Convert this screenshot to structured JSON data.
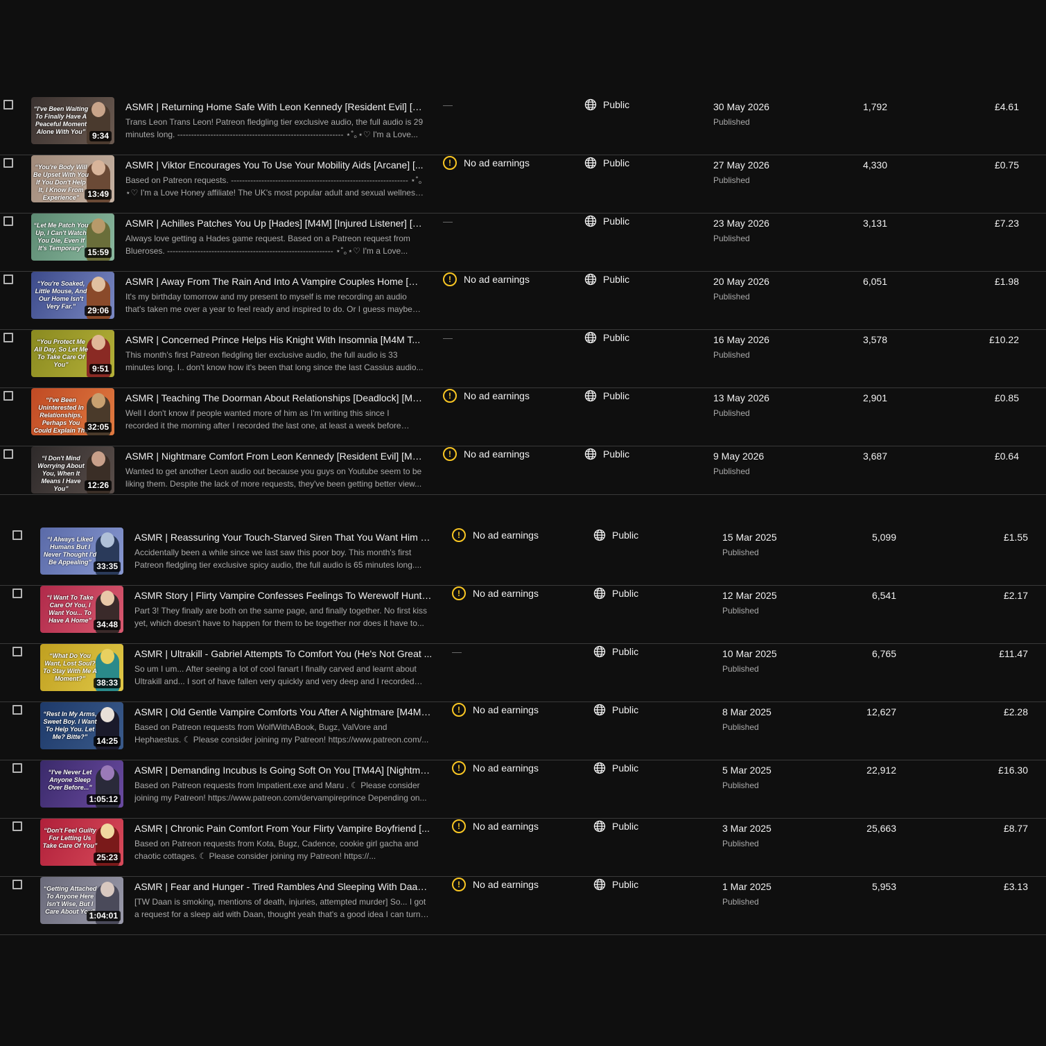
{
  "labels": {
    "published": "Published"
  },
  "group1": [
    {
      "quote": "“I've Been Waiting To Finally Have A Peaceful Moment Alone With You”",
      "duration": "9:34",
      "title": "ASMR | Returning Home Safe With Leon Kennedy [Resident Evil] [T...",
      "description": "Trans Leon Trans Leon! Patreon fledgling tier exclusive audio, the full audio is 29 minutes long. ------------------------------------------------------------ ⋆˚｡⋆♡ I'm a Love...",
      "restriction": "—",
      "visibility": "Public",
      "date": "30 May 2026",
      "status": "Published",
      "views": "1,792",
      "revenue": "£4.61",
      "colors": {
        "bg1": "#3a3230",
        "bg2": "#6b5a50",
        "figure": "#4a3a2e",
        "head": "#c8a48a"
      }
    },
    {
      "quote": "“You're Body Will Be Upset With You If You Don't Help It, I Know From Experience”",
      "duration": "13:49",
      "title": "ASMR | Viktor Encourages You To Use Your Mobility Aids [Arcane] [...",
      "description": "Based on Patreon requests. ---------------------------------------------------------------- ⋆˚｡⋆♡ I'm a Love Honey affiliate! The UK's most popular adult and sexual wellness sto...",
      "restriction": "No ad earnings",
      "visibility": "Public",
      "date": "27 May 2026",
      "status": "Published",
      "views": "4,330",
      "revenue": "£0.75",
      "colors": {
        "bg1": "#a08a7a",
        "bg2": "#c6b2a2",
        "figure": "#6b4a36",
        "head": "#d8b49a"
      }
    },
    {
      "quote": "“Let Me Patch You Up, I Can't Watch You Die, Even If It's Temporary”",
      "duration": "15:59",
      "title": "ASMR | Achilles Patches You Up [Hades] [M4M] [Injured Listener] [R...",
      "description": "Always love getting a Hades game request. Based on a Patreon request from Blueroses. ------------------------------------------------------------ ⋆˚｡⋆♡ I'm a Love...",
      "restriction": "—",
      "visibility": "Public",
      "date": "23 May 2026",
      "status": "Published",
      "views": "3,131",
      "revenue": "£7.23",
      "colors": {
        "bg1": "#5c8a72",
        "bg2": "#8ab89e",
        "figure": "#6a6e3a",
        "head": "#b89a6a"
      }
    },
    {
      "quote": "“You're Soaked, Little Mouse, And Our Home Isn't Very Far.”",
      "duration": "29:06",
      "title": "ASMR | Away From The Rain And Into A Vampire Couples Home [M...",
      "description": "It's my birthday tomorrow and my present to myself is me recording an audio that's taken me over a year to feel ready and inspired to do. Or I guess maybe I'...",
      "restriction": "No ad earnings",
      "visibility": "Public",
      "date": "20 May 2026",
      "status": "Published",
      "views": "6,051",
      "revenue": "£1.98",
      "colors": {
        "bg1": "#3c4a8a",
        "bg2": "#7a88c2",
        "figure": "#8a4a2a",
        "head": "#e0c0a0"
      }
    },
    {
      "quote": "“You Protect Me All Day, So Let Me To Take Care Of You”",
      "duration": "9:51",
      "title": "ASMR | Concerned Prince Helps His Knight With Insomnia [M4M T...",
      "description": "This month's first Patreon fledgling tier exclusive audio, the full audio is 33 minutes long. I.. don't know how it's been that long since the last Cassius audio...",
      "restriction": "—",
      "visibility": "Public",
      "date": "16 May 2026",
      "status": "Published",
      "views": "3,578",
      "revenue": "£10.22",
      "colors": {
        "bg1": "#8a8a20",
        "bg2": "#b4b038",
        "figure": "#8a2a24",
        "head": "#e0b898"
      }
    },
    {
      "quote": "“I've Been Uninterested In Relationships, Perhaps You Could Explain The Appeal”",
      "duration": "32:05",
      "title": "ASMR | Teaching The Doorman About Relationships [Deadlock] [M4...",
      "description": "Well I don't know if people wanted more of him as I'm writing this since I recorded it the morning after I recorded the last one, at least a week before that...",
      "restriction": "No ad earnings",
      "visibility": "Public",
      "date": "13 May 2026",
      "status": "Published",
      "views": "2,901",
      "revenue": "£0.85",
      "colors": {
        "bg1": "#c04a24",
        "bg2": "#e07a40",
        "figure": "#4a3a2a",
        "head": "#c8a070"
      }
    },
    {
      "quote": "“I Don't Mind Worrying About You, When It Means I Have You”",
      "duration": "12:26",
      "title": "ASMR | Nightmare Comfort From Leon Kennedy [Resident Evil] [M4...",
      "description": "Wanted to get another Leon audio out because you guys on Youtube seem to be liking them. Despite the lack of more requests, they've been getting better view...",
      "restriction": "No ad earnings",
      "visibility": "Public",
      "date": "9 May 2026",
      "status": "Published",
      "views": "3,687",
      "revenue": "£0.64",
      "colors": {
        "bg1": "#2e2a2a",
        "bg2": "#5a4e4a",
        "figure": "#3a2e26",
        "head": "#c8a08a"
      }
    }
  ],
  "group2": [
    {
      "quote": "“I Always Liked Humans But I Never Thought I'd Be Appealing”",
      "duration": "33:35",
      "title": "ASMR | Reassuring Your Touch-Starved Siren That You Want Him To...",
      "description": "Accidentally been a while since we last saw this poor boy. This month's first Patreon fledgling tier exclusive spicy audio, the full audio is 65 minutes long....",
      "restriction": "No ad earnings",
      "visibility": "Public",
      "date": "15 Mar 2025",
      "status": "Published",
      "views": "5,099",
      "revenue": "£1.55",
      "colors": {
        "bg1": "#5a6aa8",
        "bg2": "#8898d0",
        "figure": "#2a3a5a",
        "head": "#b0c0d8"
      }
    },
    {
      "quote": "“I Want To Take Care Of You, I Want You... To Have A Home”",
      "duration": "34:48",
      "title": "ASMR Story | Flirty Vampire Confesses Feelings To Werewolf Hunte...",
      "description": "Part 3! They finally are both on the same page, and finally together. No first kiss yet, which doesn't have to happen for them to be together nor does it have to...",
      "restriction": "No ad earnings",
      "visibility": "Public",
      "date": "12 Mar 2025",
      "status": "Published",
      "views": "6,541",
      "revenue": "£2.17",
      "colors": {
        "bg1": "#b02a4a",
        "bg2": "#d85a70",
        "figure": "#3a2a2a",
        "head": "#e8c8a8"
      }
    },
    {
      "quote": "“What Do You Want, Lost Soul? To Stay With Me A Moment?”",
      "duration": "38:33",
      "title": "ASMR | Ultrakill - Gabriel Attempts To Comfort You (He's Not Great ...",
      "description": "So um I um... After seeing a lot of cool fanart I finally carved and learnt about Ultrakill and... I sort of have fallen very quickly and very deep and I recorded this...",
      "restriction": "—",
      "visibility": "Public",
      "date": "10 Mar 2025",
      "status": "Published",
      "views": "6,765",
      "revenue": "£11.47",
      "colors": {
        "bg1": "#c0a020",
        "bg2": "#e0c848",
        "figure": "#2a8a8a",
        "head": "#e8d060"
      }
    },
    {
      "quote": "“Rest In My Arms, Sweet Boy. I Want To Help You. Let Me? Bitte?”",
      "duration": "14:25",
      "title": "ASMR | Old Gentle Vampire Comforts You After A Nightmare [M4M] ...",
      "description": "Based on Patreon requests from WolfWithABook, Bugz, ValVore and Hephaestus. ☾ Please consider joining my Patreon! https://www.patreon.com/...",
      "restriction": "No ad earnings",
      "visibility": "Public",
      "date": "8 Mar 2025",
      "status": "Published",
      "views": "12,627",
      "revenue": "£2.28",
      "colors": {
        "bg1": "#1e3a6a",
        "bg2": "#3a5a8a",
        "figure": "#1a1a2a",
        "head": "#e8e0d8"
      }
    },
    {
      "quote": "“I've Never Let Anyone Sleep Over Before...”",
      "duration": "1:05:12",
      "title": "ASMR | Demanding Incubus Is Going Soft On You [TM4A] [Nightmar...",
      "description": "Based on Patreon requests from Impatient.exe and Maru . ☾ Please consider joining my Patreon! https://www.patreon.com/dervampireprince Depending on...",
      "restriction": "No ad earnings",
      "visibility": "Public",
      "date": "5 Mar 2025",
      "status": "Published",
      "views": "22,912",
      "revenue": "£16.30",
      "colors": {
        "bg1": "#3a2a6a",
        "bg2": "#6a4aa0",
        "figure": "#2a2a3a",
        "head": "#9a7ab8"
      }
    },
    {
      "quote": "“Don't Feel Guilty For Letting Us Take Care Of You”",
      "duration": "25:23",
      "title": "ASMR | Chronic Pain Comfort From Your Flirty Vampire Boyfriend [...",
      "description": "Based on Patreon requests from Kota, Bugz, Cadence, cookie girl gacha and chaotic cottages. ☾ Please consider joining my Patreon! https://...",
      "restriction": "No ad earnings",
      "visibility": "Public",
      "date": "3 Mar 2025",
      "status": "Published",
      "views": "25,663",
      "revenue": "£8.77",
      "colors": {
        "bg1": "#b0203a",
        "bg2": "#d84a5a",
        "figure": "#7a1a1a",
        "head": "#f0d8a0"
      }
    },
    {
      "quote": "“Getting Attached To Anyone Here Isn't Wise, But I Care About You”",
      "duration": "1:04:01",
      "title": "ASMR | Fear and Hunger - Tired Rambles And Sleeping With Daan [...",
      "description": "[TW Daan is smoking, mentions of death, injuries, attempted murder] So... I got a request for a sleep aid with Daan, thought yeah that's a good idea I can turn tha...",
      "restriction": "No ad earnings",
      "visibility": "Public",
      "date": "1 Mar 2025",
      "status": "Published",
      "views": "5,953",
      "revenue": "£3.13",
      "colors": {
        "bg1": "#6a6a7a",
        "bg2": "#9a9aaa",
        "figure": "#4a4a5a",
        "head": "#d8c8c0"
      }
    }
  ]
}
